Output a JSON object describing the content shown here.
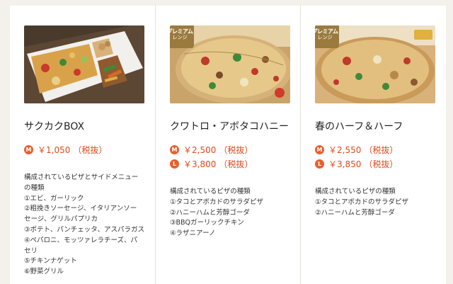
{
  "products": [
    {
      "name": "サクカクBOX",
      "premium": false,
      "prices": [
        {
          "size": "M",
          "price": "￥1,050",
          "tax": "（税抜）"
        }
      ],
      "description": [
        "構成されているピザとサイドメニュー",
        "の種類",
        "①エビ、ガーリック",
        "②粗挽きソーセージ、イタリアンソー",
        "セージ、グリルパプリカ",
        "③ポテト、パンチェッタ、アスパラガス",
        "④ペパロニ、モッツァレラチーズ、パ",
        "セリ",
        "⑤チキンナゲット",
        "⑥野菜グリル"
      ]
    },
    {
      "name": "クワトロ・アボタコハニー",
      "premium": true,
      "badge": {
        "line1": "プレミアム",
        "line2": "レンジ"
      },
      "prices": [
        {
          "size": "M",
          "price": "￥2,500",
          "tax": "（税抜）"
        },
        {
          "size": "L",
          "price": "￥3,800",
          "tax": "（税抜）"
        }
      ],
      "description": [
        "構成されているピザの種類",
        "①タコとアボカドのサラダピザ",
        "②ハニーハムと芳醇ゴーダ",
        "③BBQガーリックチキン",
        "④ラザニアーノ"
      ]
    },
    {
      "name": "春のハーフ＆ハーフ",
      "premium": true,
      "badge": {
        "line1": "プレミアム",
        "line2": "レンジ"
      },
      "prices": [
        {
          "size": "M",
          "price": "￥2,550",
          "tax": "（税抜）"
        },
        {
          "size": "L",
          "price": "￥3,850",
          "tax": "（税抜）"
        }
      ],
      "description": [
        "構成されているピザの種類",
        "①タコとアボカドのサラダピザ",
        "②ハニーハムと芳醇ゴーダ"
      ]
    }
  ],
  "colors": {
    "price": "#e0491e",
    "size_icon": "#e95f2b",
    "badge": "#9a7a3d"
  }
}
